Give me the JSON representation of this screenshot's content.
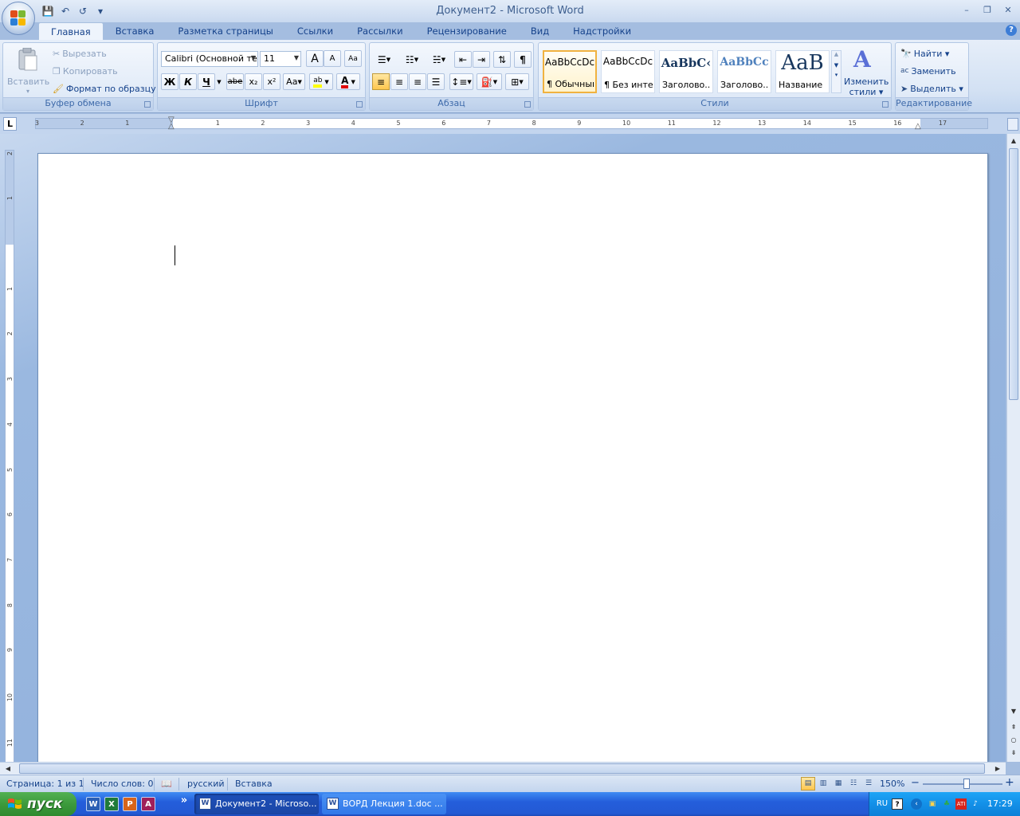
{
  "window": {
    "title": "Документ2 - Microsoft Word",
    "controls": {
      "minimize": "–",
      "restore": "❐",
      "close": "✕"
    }
  },
  "qat": {
    "save": "💾",
    "undo": "↶",
    "redo": "↺",
    "customize": "▾"
  },
  "ribbon": {
    "tabs": [
      "Главная",
      "Вставка",
      "Разметка страницы",
      "Ссылки",
      "Рассылки",
      "Рецензирование",
      "Вид",
      "Надстройки"
    ],
    "active_tab": "Главная",
    "help": "?",
    "clipboard": {
      "title": "Буфер обмена",
      "paste": "Вставить",
      "paste_dd": "▾",
      "cut": "Вырезать",
      "copy": "Копировать",
      "format_painter": "Формат по образцу"
    },
    "font": {
      "title": "Шрифт",
      "font_name": "Calibri (Основной те",
      "font_size": "11",
      "grow": "A",
      "shrink": "A",
      "clear": "Aa",
      "bold": "Ж",
      "italic": "К",
      "underline": "Ч",
      "strike": "abe",
      "subscript": "x₂",
      "superscript": "x²",
      "case": "Aa",
      "highlight": "ab",
      "font_color": "A"
    },
    "paragraph": {
      "title": "Абзац"
    },
    "styles": {
      "title": "Стили",
      "items": [
        {
          "sample": "AaBbCcDc",
          "name": "¶ Обычный"
        },
        {
          "sample": "AaBbCcDc",
          "name": "¶ Без инте..."
        },
        {
          "sample": "AaBbC‹",
          "name": "Заголово..."
        },
        {
          "sample": "AaBbCc",
          "name": "Заголово..."
        },
        {
          "sample": "AaB",
          "name": "Название"
        }
      ],
      "change_styles_line1": "Изменить",
      "change_styles_line2": "стили ▾"
    },
    "editing": {
      "title": "Редактирование",
      "find": "Найти ▾",
      "replace": "Заменить",
      "select": "Выделить ▾"
    }
  },
  "ruler": {
    "tab_selector": "L",
    "h_labels": [
      "3",
      "2",
      "1",
      "1",
      "2",
      "3",
      "4",
      "5",
      "6",
      "7",
      "8",
      "9",
      "10",
      "11",
      "12",
      "13",
      "14",
      "15",
      "16",
      "17"
    ],
    "v_labels": [
      "2",
      "1",
      "1",
      "2",
      "3",
      "4",
      "5",
      "6",
      "7",
      "8",
      "9",
      "10",
      "11"
    ]
  },
  "statusbar": {
    "page": "Страница: 1 из 1",
    "words": "Число слов: 0",
    "language": "русский",
    "mode": "Вставка",
    "zoom": "150%",
    "zoom_minus": "−",
    "zoom_plus": "+"
  },
  "taskbar": {
    "start": "пуск",
    "quick_more": "»",
    "buttons": [
      {
        "label": "Документ2 - Microso...",
        "active": true
      },
      {
        "label": "ВОРД Лекция 1.doc ...",
        "active": false
      }
    ],
    "tray": {
      "lang": "RU",
      "clock": "17:29"
    }
  },
  "colors": {
    "ribbon_text": "#15428b",
    "accent_active": "#ffc74f",
    "taskbar": "#245edb",
    "start": "#3c9a3c"
  }
}
